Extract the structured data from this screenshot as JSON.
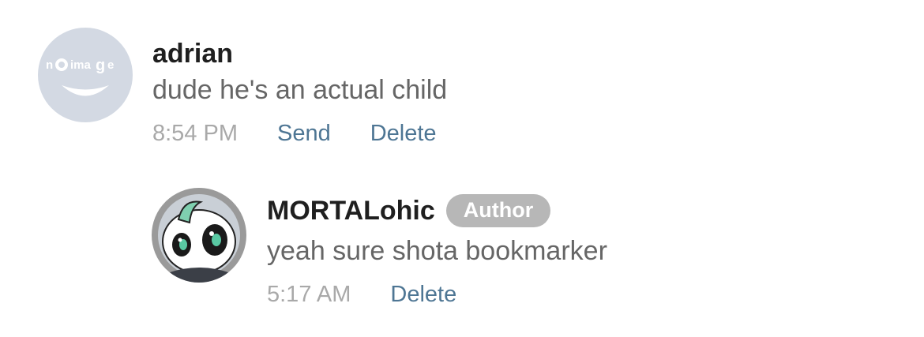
{
  "comments": [
    {
      "username": "adrian",
      "avatar": "no-image-placeholder",
      "avatar_text": "nO image",
      "message": "dude he's an actual child",
      "time": "8:54 PM",
      "actions": {
        "send": "Send",
        "delete": "Delete"
      }
    },
    {
      "username": "MORTALohic",
      "badge": "Author",
      "avatar": "cartoon-character",
      "message": "yeah sure shota bookmarker",
      "time": "5:17 AM",
      "actions": {
        "delete": "Delete"
      }
    }
  ],
  "colors": {
    "username": "#1f1f1f",
    "message": "#666666",
    "timestamp": "#a9a9a9",
    "link": "#4e7694",
    "badge_bg": "#b7b7b7",
    "placeholder_bg": "#d3d9e3"
  }
}
